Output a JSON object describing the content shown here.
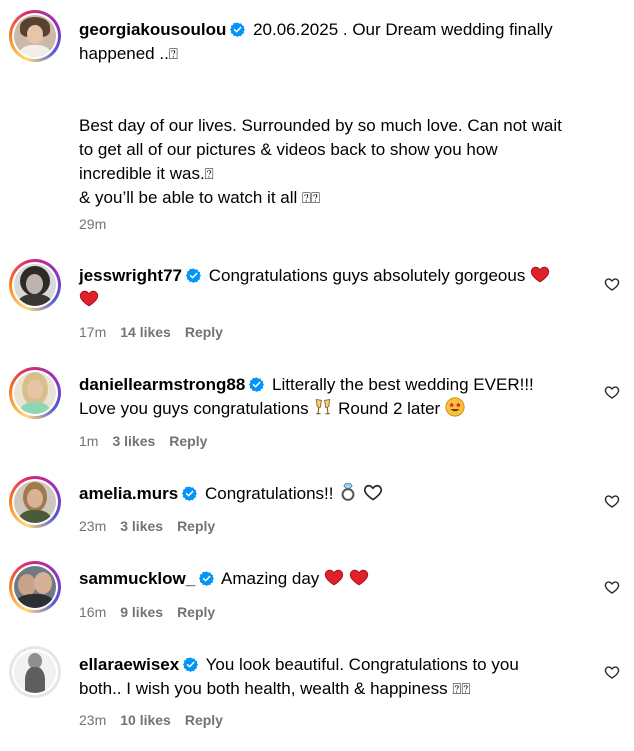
{
  "post": {
    "username": "georgiakousoulou",
    "caption_line1": "20.06.2025 . Our Dream wedding finally",
    "caption_line2": "happened ..",
    "body_line1": "Best day of our lives. Surrounded by so much love. Can not wait",
    "body_line2": "to get all of our pictures & videos back to show you how",
    "body_line3": "incredible it was.",
    "body_line4": "& you’ll be able to watch it all",
    "time": "29m",
    "box_glyph": "⍰",
    "box_glyph_double": "⍰⍰"
  },
  "comments": [
    {
      "username": "jesswright77",
      "text": "Congratulations guys absolutely gorgeous",
      "time": "17m",
      "likes": "14 likes",
      "reply": "Reply",
      "emojis": [
        "red-heart",
        "red-heart"
      ]
    },
    {
      "username": "daniellearmstrong88",
      "text_line1": "Litterally the best wedding EVER!!!",
      "text_line2a": "Love you guys congratulations",
      "text_line2b": "Round 2 later",
      "time": "1m",
      "likes": "3 likes",
      "reply": "Reply",
      "emojis": [
        "clinking-glasses",
        "star-struck"
      ]
    },
    {
      "username": "amelia.murs",
      "text": "Congratulations!!",
      "time": "23m",
      "likes": "3 likes",
      "reply": "Reply",
      "emojis": [
        "ring",
        "white-heart"
      ]
    },
    {
      "username": "sammucklow_",
      "text": "Amazing day",
      "time": "16m",
      "likes": "9 likes",
      "reply": "Reply",
      "emojis": [
        "red-heart",
        "red-heart"
      ]
    },
    {
      "username": "ellaraewisex",
      "text_line1": "You look beautiful. Congratulations to you",
      "text_line2": "both.. I wish you both health, wealth & happiness",
      "time": "23m",
      "likes": "10 likes",
      "reply": "Reply",
      "emojis": []
    }
  ],
  "colors": {
    "verified_blue": "#0095f6",
    "meta_gray": "#737373",
    "heart_red": "#e0202a"
  }
}
